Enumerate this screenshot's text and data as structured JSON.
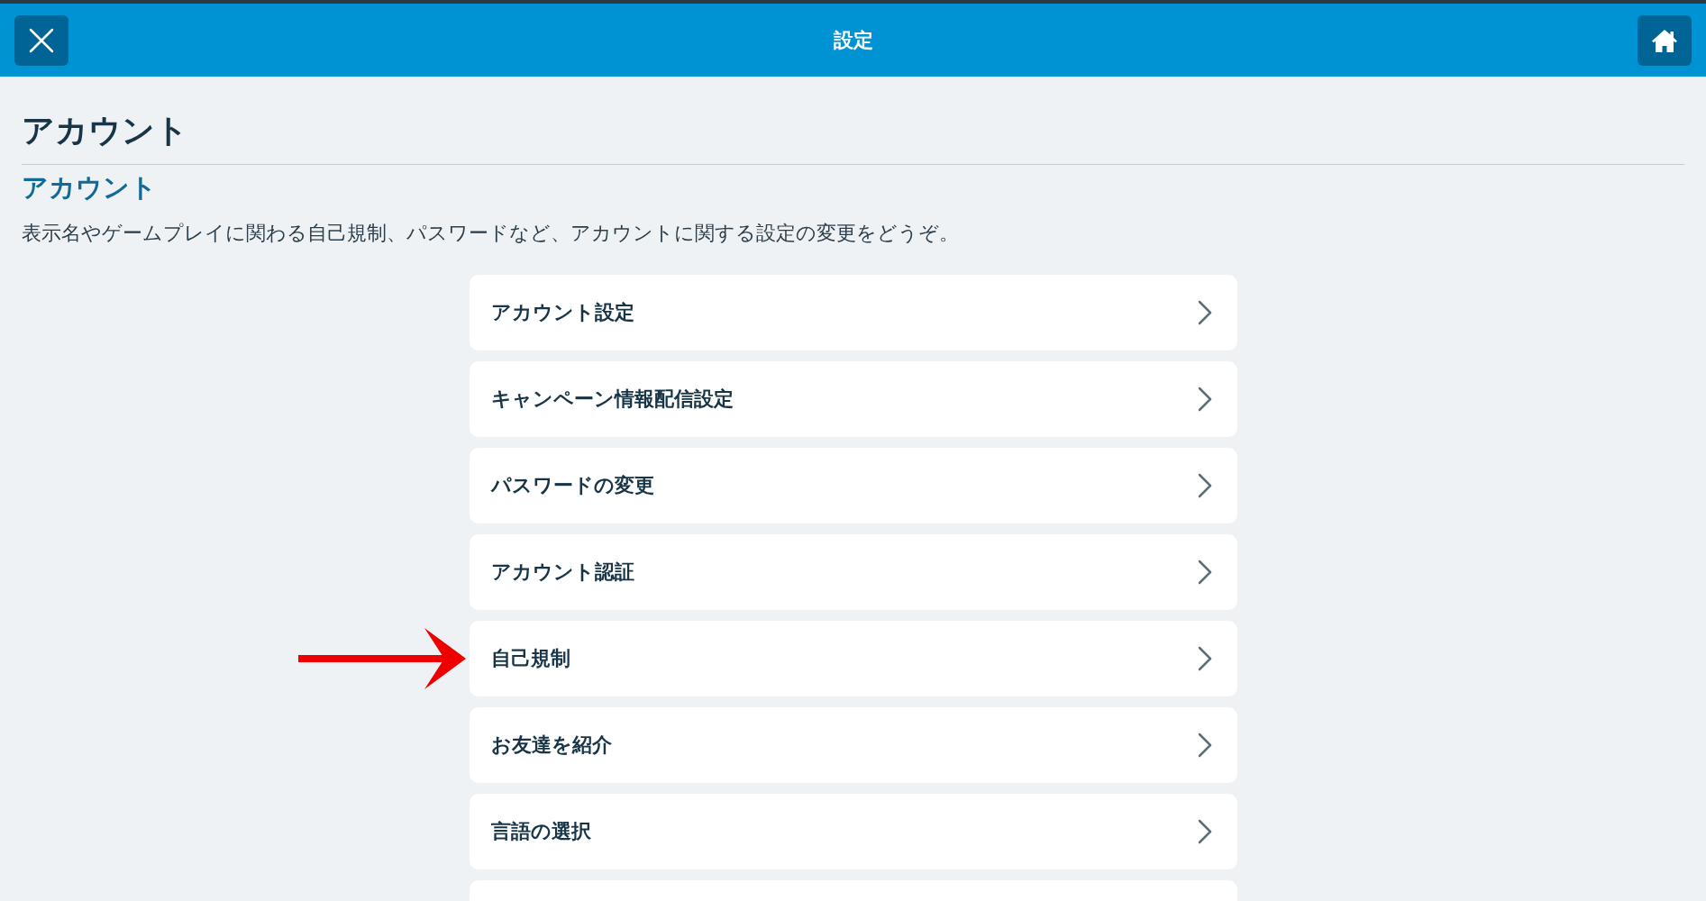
{
  "header": {
    "title": "設定"
  },
  "page_title": "アカウント",
  "section": {
    "title": "アカウント",
    "description": "表示名やゲームプレイに関わる自己規制、パスワードなど、アカウントに関する設定の変更をどうぞ。"
  },
  "menu_items": [
    {
      "label": "アカウント設定",
      "annotated": false
    },
    {
      "label": "キャンペーン情報配信設定",
      "annotated": false
    },
    {
      "label": "パスワードの変更",
      "annotated": false
    },
    {
      "label": "アカウント認証",
      "annotated": false
    },
    {
      "label": "自己規制",
      "annotated": true
    },
    {
      "label": "お友達を紹介",
      "annotated": false
    },
    {
      "label": "言語の選択",
      "annotated": false
    }
  ]
}
